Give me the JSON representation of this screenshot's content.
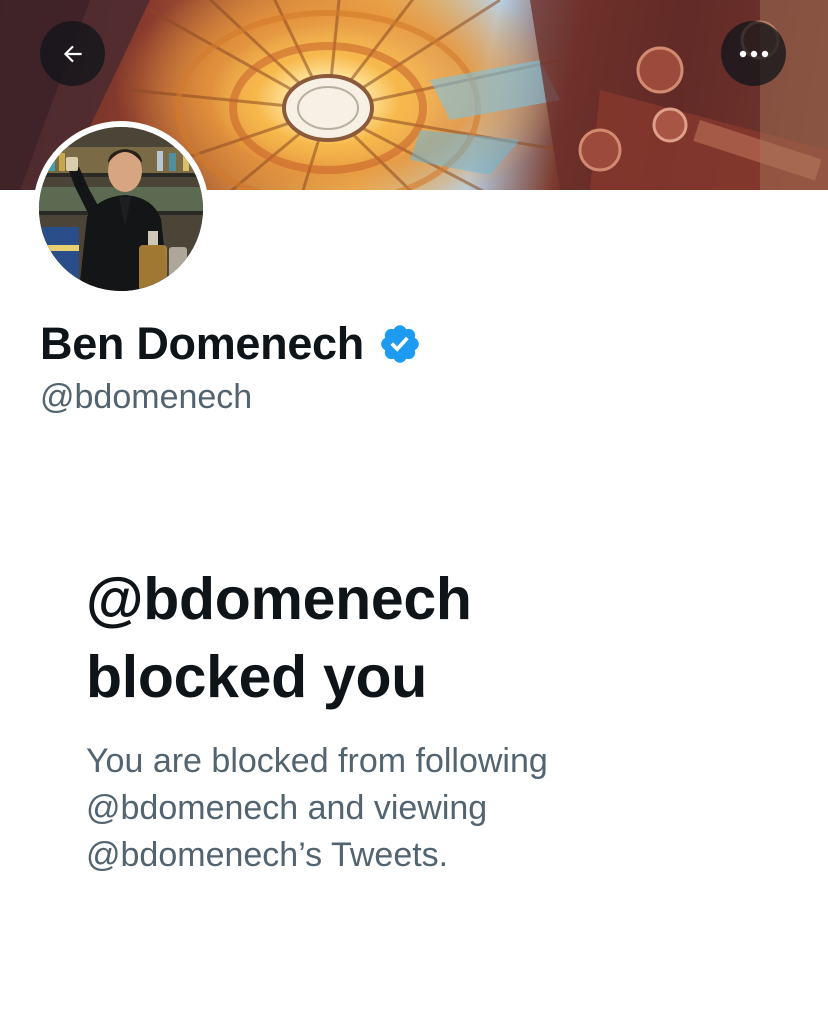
{
  "header": {
    "back_icon": "arrow-left-icon",
    "more_icon": "more-horizontal-icon",
    "more_label": "•••"
  },
  "profile": {
    "display_name": "Ben Domenech",
    "handle": "@bdomenech",
    "verified_icon": "verified-badge-icon",
    "verified_color": "#1d9bf0"
  },
  "blocked": {
    "title_line1": "@bdomenech",
    "title_line2": "blocked you",
    "desc_line1": "You are blocked from following",
    "desc_line2": "@bdomenech and viewing",
    "desc_line3": "@bdomenech’s Tweets."
  }
}
